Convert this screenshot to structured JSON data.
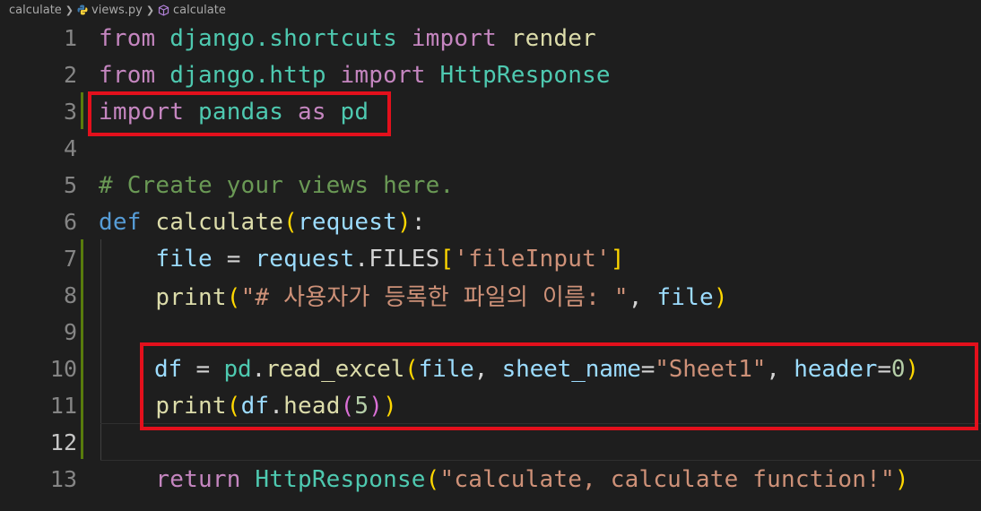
{
  "breadcrumb": {
    "folder": "calculate",
    "file": "views.py",
    "symbol": "calculate"
  },
  "line_numbers": [
    "1",
    "2",
    "3",
    "4",
    "5",
    "6",
    "7",
    "8",
    "9",
    "10",
    "11",
    "12",
    "13"
  ],
  "code": {
    "l1": {
      "kw1": "from",
      "mod1": "django.shortcuts",
      "kw2": "import",
      "name": "render"
    },
    "l2": {
      "kw1": "from",
      "mod1": "django.http",
      "kw2": "import",
      "name": "HttpResponse"
    },
    "l3": {
      "kw1": "import",
      "mod1": "pandas",
      "kw2": "as",
      "name": "pd"
    },
    "l5": {
      "comment": "# Create your views here."
    },
    "l6": {
      "kw": "def",
      "fn": "calculate",
      "open": "(",
      "param": "request",
      "close": ")",
      "colon": ":"
    },
    "l7": {
      "var": "file",
      "eq": " = ",
      "obj": "request",
      "dot": ".",
      "attr": "FILES",
      "open": "[",
      "str": "'fileInput'",
      "close": "]"
    },
    "l8": {
      "fn": "print",
      "open": "(",
      "str": "\"# 사용자가 등록한 파일의 이름: \"",
      "comma": ", ",
      "var": "file",
      "close": ")"
    },
    "l10": {
      "var": "df",
      "eq": " = ",
      "mod": "pd",
      "dot": ".",
      "fn": "read_excel",
      "open": "(",
      "arg1": "file",
      "comma1": ", ",
      "kw1": "sheet_name",
      "eq1": "=",
      "str": "\"Sheet1\"",
      "comma2": ", ",
      "kw2": "header",
      "eq2": "=",
      "num": "0",
      "close": ")"
    },
    "l11": {
      "fn": "print",
      "open1": "(",
      "obj": "df",
      "dot": ".",
      "fn2": "head",
      "open2": "(",
      "num": "5",
      "close2": ")",
      "close1": ")"
    },
    "l13": {
      "kw": "return",
      "cls": "HttpResponse",
      "open": "(",
      "str": "\"calculate, calculate function!\"",
      "close": ")"
    }
  }
}
